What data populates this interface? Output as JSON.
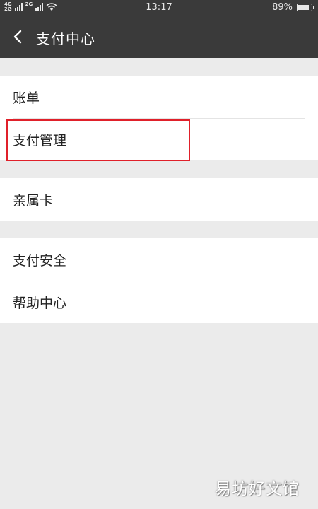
{
  "status_bar": {
    "network_top": "4G",
    "network_bottom": "2G",
    "network2": "2G",
    "time": "13:17",
    "battery_percent": "89%",
    "battery_level": 0.89
  },
  "header": {
    "title": "支付中心",
    "back_icon": "chevron-left-icon"
  },
  "menu": {
    "group1": [
      {
        "label": "账单"
      },
      {
        "label": "支付管理"
      }
    ],
    "group2": [
      {
        "label": "亲属卡"
      }
    ],
    "group3": [
      {
        "label": "支付安全"
      },
      {
        "label": "帮助中心"
      }
    ]
  },
  "colors": {
    "header_bg": "#3a3a3a",
    "page_bg": "#ebebeb",
    "highlight_border": "#e0202a"
  },
  "watermark": "易坊好文馆"
}
